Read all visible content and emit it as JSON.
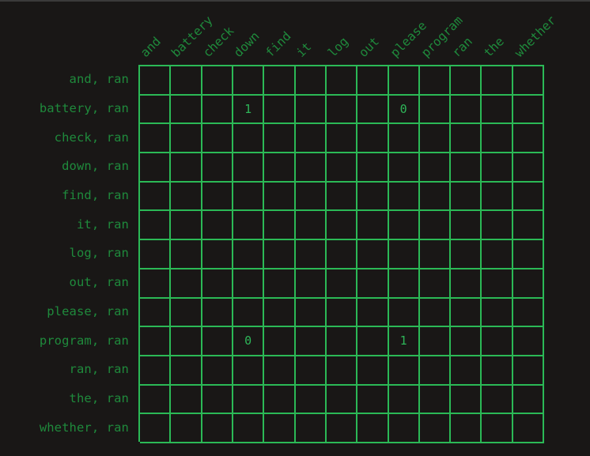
{
  "chart_data": {
    "type": "heatmap",
    "title": "",
    "xlabel": "",
    "ylabel": "",
    "grid": true,
    "legend": false,
    "columns": [
      "and",
      "battery",
      "check",
      "down",
      "find",
      "it",
      "log",
      "out",
      "please",
      "program",
      "ran",
      "the",
      "whether"
    ],
    "rows": [
      "and, ran",
      "battery, ran",
      "check, ran",
      "down, ran",
      "find, ran",
      "it, ran",
      "log, ran",
      "out, ran",
      "please, ran",
      "program, ran",
      "ran, ran",
      "the, ran",
      "whether, ran"
    ],
    "cells": [
      [
        "",
        "",
        "",
        "",
        "",
        "",
        "",
        "",
        "",
        "",
        "",
        "",
        ""
      ],
      [
        "",
        "",
        "",
        "1",
        "",
        "",
        "",
        "",
        "0",
        "",
        "",
        "",
        ""
      ],
      [
        "",
        "",
        "",
        "",
        "",
        "",
        "",
        "",
        "",
        "",
        "",
        "",
        ""
      ],
      [
        "",
        "",
        "",
        "",
        "",
        "",
        "",
        "",
        "",
        "",
        "",
        "",
        ""
      ],
      [
        "",
        "",
        "",
        "",
        "",
        "",
        "",
        "",
        "",
        "",
        "",
        "",
        ""
      ],
      [
        "",
        "",
        "",
        "",
        "",
        "",
        "",
        "",
        "",
        "",
        "",
        "",
        ""
      ],
      [
        "",
        "",
        "",
        "",
        "",
        "",
        "",
        "",
        "",
        "",
        "",
        "",
        ""
      ],
      [
        "",
        "",
        "",
        "",
        "",
        "",
        "",
        "",
        "",
        "",
        "",
        "",
        ""
      ],
      [
        "",
        "",
        "",
        "",
        "",
        "",
        "",
        "",
        "",
        "",
        "",
        "",
        ""
      ],
      [
        "",
        "",
        "",
        "0",
        "",
        "",
        "",
        "",
        "1",
        "",
        "",
        "",
        ""
      ],
      [
        "",
        "",
        "",
        "",
        "",
        "",
        "",
        "",
        "",
        "",
        "",
        "",
        ""
      ],
      [
        "",
        "",
        "",
        "",
        "",
        "",
        "",
        "",
        "",
        "",
        "",
        "",
        ""
      ],
      [
        "",
        "",
        "",
        "",
        "",
        "",
        "",
        "",
        "",
        "",
        "",
        "",
        ""
      ]
    ],
    "annotated_points": [
      {
        "row": "battery, ran",
        "column": "down",
        "value": "1"
      },
      {
        "row": "battery, ran",
        "column": "please",
        "value": "0"
      },
      {
        "row": "program, ran",
        "column": "down",
        "value": "0"
      },
      {
        "row": "program, ran",
        "column": "please",
        "value": "1"
      }
    ]
  },
  "colors": {
    "background": "#191716",
    "grid_line": "#2bb956",
    "label_text": "#1f8a3c",
    "value_text": "#2eb558",
    "top_strip": "#3a3a3a"
  }
}
